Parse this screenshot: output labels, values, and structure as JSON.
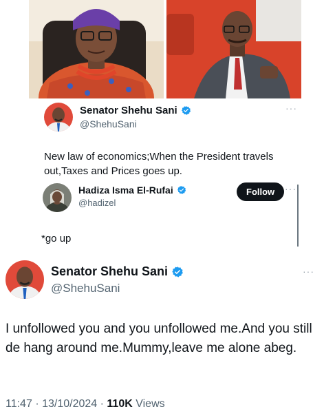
{
  "quoted_tweet": {
    "author_name": "Senator Shehu Sani",
    "author_handle": "@ShehuSani",
    "more": "···",
    "text": "New law of economics;When the President travels out,Taxes and Prices goes up."
  },
  "reply_tweet": {
    "author_name": "Hadiza Isma El-Rufai",
    "author_handle": "@hadizel",
    "follow_label": "Follow",
    "more": "···",
    "text": "*go up"
  },
  "main_tweet": {
    "author_name": "Senator Shehu Sani",
    "author_handle": "@ShehuSani",
    "more": "···",
    "text": "I unfollowed you and you unfollowed me.And you still de hang around me.Mummy,leave me alone abeg.",
    "time": "11:47",
    "separator": "·",
    "date": "13/10/2024",
    "views_count": "110K",
    "views_label": "Views"
  },
  "colors": {
    "verified": "#1d9bf0",
    "text": "#0f1419",
    "muted": "#536471"
  },
  "icons": [
    "verified-badge-icon",
    "more-options-icon"
  ]
}
